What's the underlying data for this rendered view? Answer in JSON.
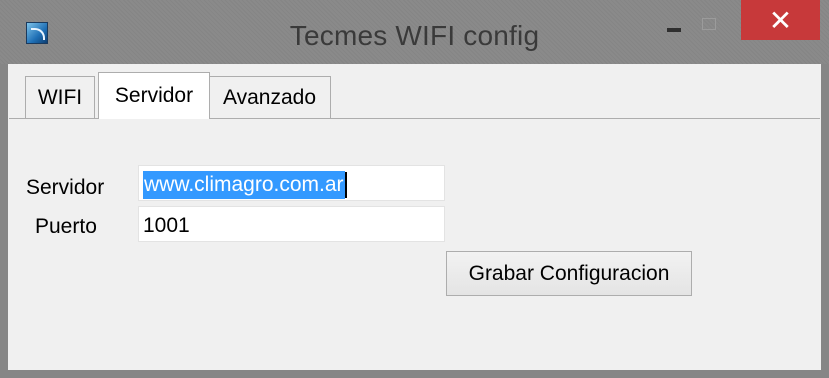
{
  "window": {
    "title": "Tecmes WIFI config",
    "close_glyph": "✕",
    "icon": "tecmes-app-icon"
  },
  "tabs": [
    {
      "label": "WIFI",
      "active": false
    },
    {
      "label": "Servidor",
      "active": true
    },
    {
      "label": "Avanzado",
      "active": false
    }
  ],
  "form": {
    "server_label": "Servidor",
    "server_value": "www.climagro.com.ar",
    "port_label": "Puerto",
    "port_value": "1001",
    "save_label": "Grabar Configuracion"
  },
  "colors": {
    "close_button": "#c7393a",
    "selection": "#3399ff",
    "panel": "#f0f0f0"
  }
}
